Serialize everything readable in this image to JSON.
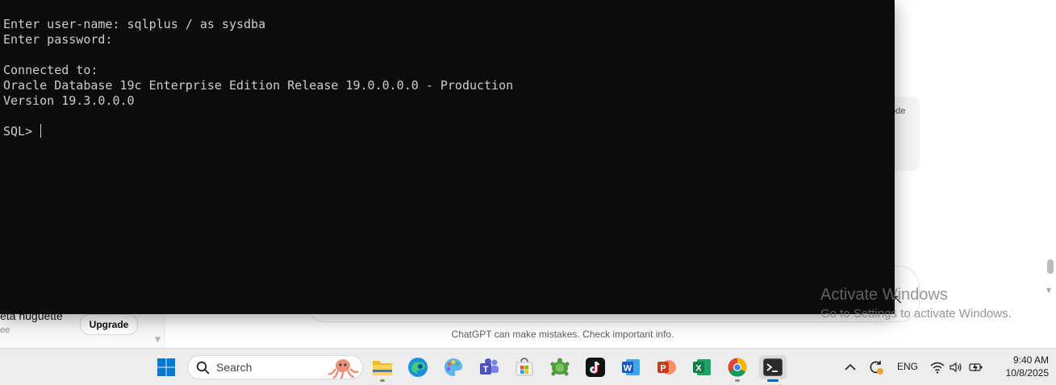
{
  "background_app": {
    "user_name": "eta nuguette",
    "user_plan": "ee",
    "upgrade_label": "Upgrade",
    "card_fragment": "ode",
    "disclaimer": "ChatGPT can make mistakes. Check important info."
  },
  "terminal": {
    "lines": [
      "Enter user-name: sqlplus / as sysdba",
      "Enter password:",
      "",
      "Connected to:",
      "Oracle Database 19c Enterprise Edition Release 19.0.0.0.0 - Production",
      "Version 19.3.0.0.0",
      "",
      "SQL> "
    ]
  },
  "watermark": {
    "title": "Activate Windows",
    "subtitle": "Go to Settings to activate Windows."
  },
  "taskbar": {
    "search_placeholder": "Search",
    "apps": [
      {
        "name": "file-explorer",
        "running": true
      },
      {
        "name": "edge",
        "running": false
      },
      {
        "name": "paint",
        "running": false
      },
      {
        "name": "teams",
        "running": false
      },
      {
        "name": "microsoft-store",
        "running": false
      },
      {
        "name": "turtle-app",
        "running": false
      },
      {
        "name": "tiktok",
        "running": false
      },
      {
        "name": "word",
        "running": false
      },
      {
        "name": "powerpoint",
        "running": false
      },
      {
        "name": "excel",
        "running": false
      },
      {
        "name": "chrome",
        "running": true
      },
      {
        "name": "terminal",
        "running": true,
        "active": true
      }
    ],
    "tray": {
      "language": "ENG",
      "time": "9:40 AM",
      "date": "10/8/2025"
    }
  },
  "colors": {
    "terminal_bg": "#0c0c0c",
    "terminal_fg": "#cccccc",
    "taskbar_bg": "#ededed",
    "accent": "#0067c0"
  }
}
